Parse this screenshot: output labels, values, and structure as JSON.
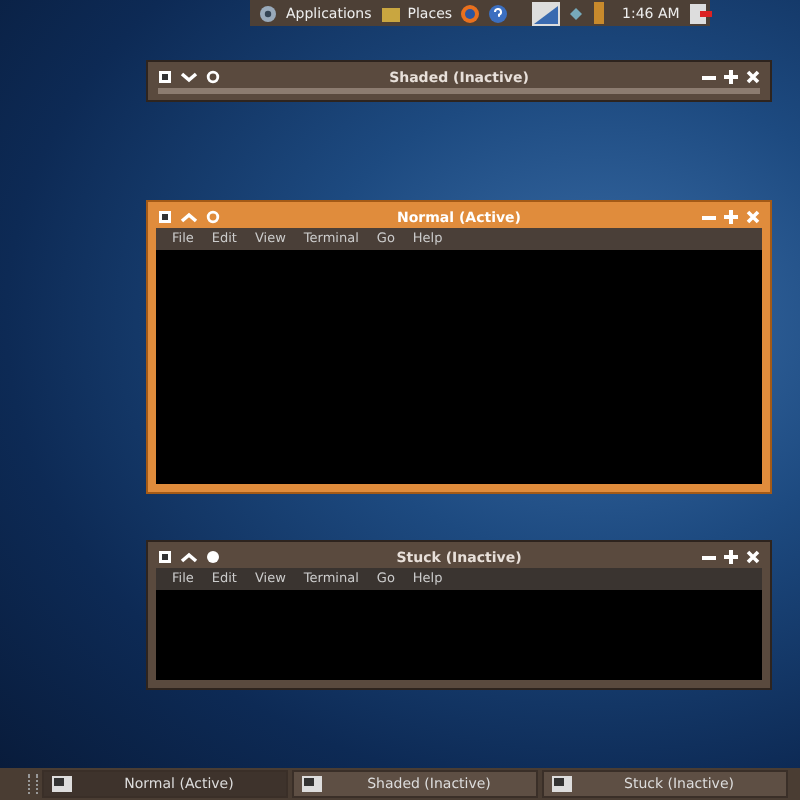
{
  "top_panel": {
    "menus": [
      {
        "label": "Applications"
      },
      {
        "label": "Places"
      }
    ],
    "clock": "1:46 AM"
  },
  "windows": [
    {
      "title": "Shaded (Inactive)",
      "active": false,
      "shaded": true,
      "stuck": false
    },
    {
      "title": "Normal (Active)",
      "active": true,
      "shaded": false,
      "stuck": false,
      "menu": [
        "File",
        "Edit",
        "View",
        "Terminal",
        "Go",
        "Help"
      ]
    },
    {
      "title": "Stuck (Inactive)",
      "active": false,
      "shaded": false,
      "stuck": true,
      "menu": [
        "File",
        "Edit",
        "View",
        "Terminal",
        "Go",
        "Help"
      ]
    }
  ],
  "taskbar": [
    {
      "label": "Normal (Active)",
      "selected": true
    },
    {
      "label": "Shaded (Inactive)",
      "selected": false
    },
    {
      "label": "Stuck (Inactive)",
      "selected": false
    }
  ]
}
